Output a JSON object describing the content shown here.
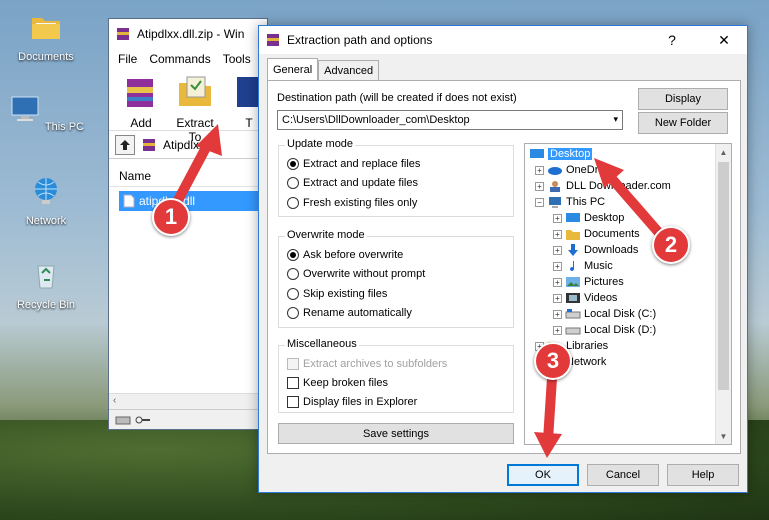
{
  "desktop": {
    "icons": [
      {
        "label": "Documents"
      },
      {
        "label": "This PC"
      },
      {
        "label": "Network"
      },
      {
        "label": "Recycle Bin"
      }
    ]
  },
  "winrar": {
    "title": "Atipdlxx.dll.zip - Win",
    "menu": [
      "File",
      "Commands",
      "Tools"
    ],
    "toolbar": {
      "add": "Add",
      "extract": "Extract To",
      "test": "T"
    },
    "path": "Atipdlxx.dll",
    "column_name": "Name",
    "selected_file": "atipdlxx.dll"
  },
  "dialog": {
    "title": "Extraction path and options",
    "help": "?",
    "close": "✕",
    "tabs": [
      "General",
      "Advanced"
    ],
    "dest_label": "Destination path (will be created if does not exist)",
    "dest_value": "C:\\Users\\DllDownloader_com\\Desktop",
    "display_button": "Display",
    "new_folder_button": "New Folder",
    "update_mode": {
      "title": "Update mode",
      "options": [
        "Extract and replace files",
        "Extract and update files",
        "Fresh existing files only"
      ],
      "selected": 0
    },
    "overwrite_mode": {
      "title": "Overwrite mode",
      "options": [
        "Ask before overwrite",
        "Overwrite without prompt",
        "Skip existing files",
        "Rename automatically"
      ],
      "selected": 0
    },
    "misc": {
      "title": "Miscellaneous",
      "options": [
        "Extract archives to subfolders",
        "Keep broken files",
        "Display files in Explorer"
      ]
    },
    "save_settings": "Save settings",
    "tree": [
      "Desktop",
      "OneDrive",
      "DLL Downloader.com",
      "This PC",
      "Desktop",
      "Documents",
      "Downloads",
      "Music",
      "Pictures",
      "Videos",
      "Local Disk (C:)",
      "Local Disk (D:)",
      "Libraries",
      "Network"
    ],
    "ok": "OK",
    "cancel": "Cancel",
    "help_button": "Help"
  },
  "annotations": [
    "1",
    "2",
    "3"
  ],
  "colors": {
    "accent": "#0078d7",
    "selection": "#3399ff",
    "badge": "#e2393b"
  }
}
